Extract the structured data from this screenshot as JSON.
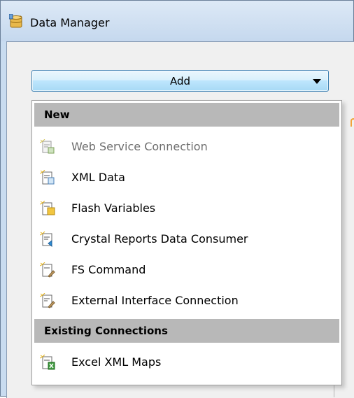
{
  "window": {
    "title": "Data Manager",
    "title_icon": "database-icon"
  },
  "add_button": {
    "label": "Add",
    "dropdown_icon": "chevron-down-icon"
  },
  "menu": {
    "sections": [
      {
        "header": "New",
        "items": [
          {
            "label": "Web Service Connection",
            "icon": "web-service-connection-icon",
            "enabled": false
          },
          {
            "label": "XML Data",
            "icon": "xml-data-icon",
            "enabled": true
          },
          {
            "label": "Flash Variables",
            "icon": "flash-variables-icon",
            "enabled": true
          },
          {
            "label": "Crystal Reports Data Consumer",
            "icon": "crystal-reports-icon",
            "enabled": true
          },
          {
            "label": "FS Command",
            "icon": "fs-command-icon",
            "enabled": true
          },
          {
            "label": "External Interface Connection",
            "icon": "external-interface-icon",
            "enabled": true
          }
        ]
      },
      {
        "header": "Existing Connections",
        "items": [
          {
            "label": "Excel XML Maps",
            "icon": "excel-xml-maps-icon",
            "enabled": true
          }
        ]
      }
    ]
  },
  "colors": {
    "section_header_bg": "#b8b8b8",
    "button_border": "#3c7fb1",
    "disabled_text": "#6d6d6d"
  }
}
